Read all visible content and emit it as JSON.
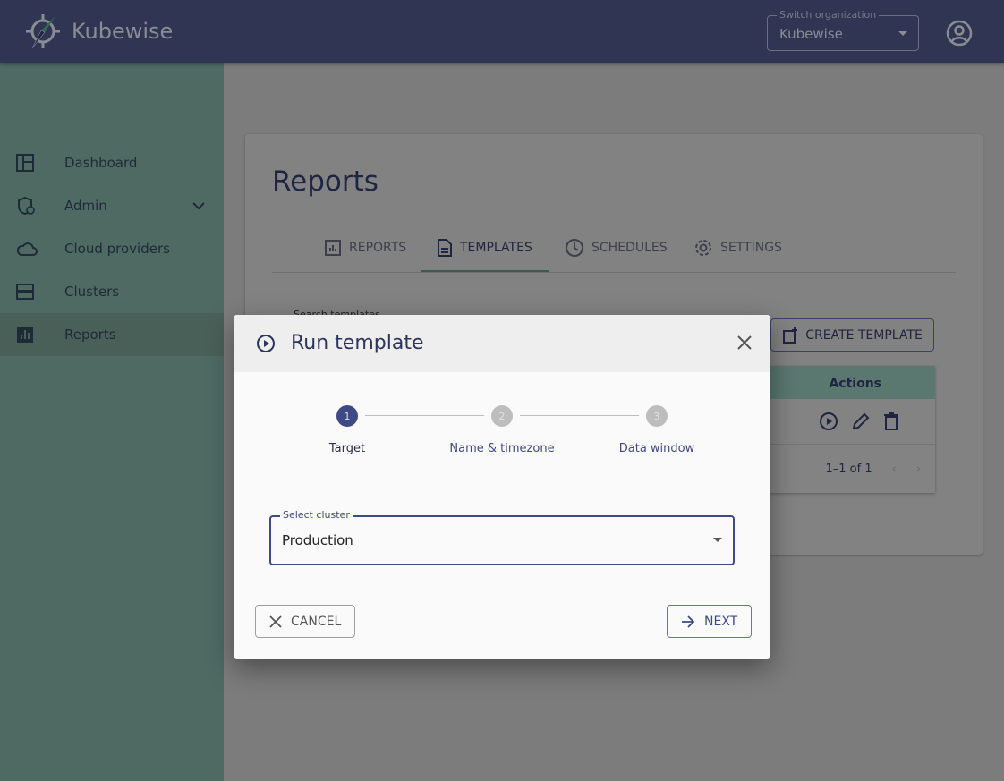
{
  "header": {
    "brand": "Kubewise",
    "org_switch": {
      "label": "Switch organization",
      "value": "Kubewise"
    }
  },
  "sidebar": {
    "items": [
      {
        "label": "Dashboard"
      },
      {
        "label": "Admin"
      },
      {
        "label": "Cloud providers"
      },
      {
        "label": "Clusters"
      },
      {
        "label": "Reports",
        "selected": true
      }
    ]
  },
  "page": {
    "title": "Reports",
    "tabs": [
      {
        "label": "REPORTS"
      },
      {
        "label": "TEMPLATES",
        "active": true
      },
      {
        "label": "SCHEDULES"
      },
      {
        "label": "SETTINGS"
      }
    ],
    "search_label": "Search templates",
    "create_label": "CREATE TEMPLATE",
    "table": {
      "actions_header": "Actions",
      "pagination": "1–1 of 1"
    }
  },
  "modal": {
    "title": "Run template",
    "steps": [
      {
        "num": "1",
        "label": "Target"
      },
      {
        "num": "2",
        "label": "Name & timezone"
      },
      {
        "num": "3",
        "label": "Data window"
      }
    ],
    "field": {
      "label": "Select cluster",
      "value": "Production"
    },
    "cancel": "CANCEL",
    "next": "NEXT"
  }
}
